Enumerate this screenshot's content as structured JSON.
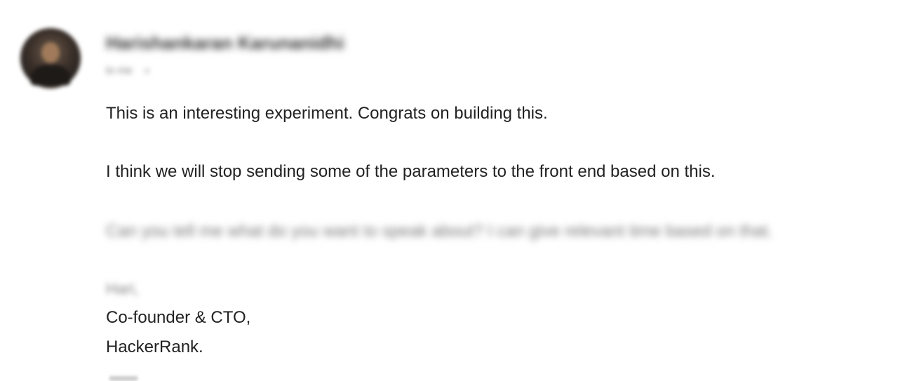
{
  "sender": {
    "name": "Harishankaran Karunanidhi",
    "recipient_label": "to me",
    "caret": "▾"
  },
  "body": {
    "line1": "This is an interesting experiment. Congrats on building this.",
    "line2": "I think we will stop sending some of the parameters to the front end based on this.",
    "line3": "Can you tell me what do you want to speak about? I can give relevant time based on that.",
    "sign_name": "Hari,",
    "sign_title": "Co-founder & CTO,",
    "sign_company": "HackerRank."
  }
}
